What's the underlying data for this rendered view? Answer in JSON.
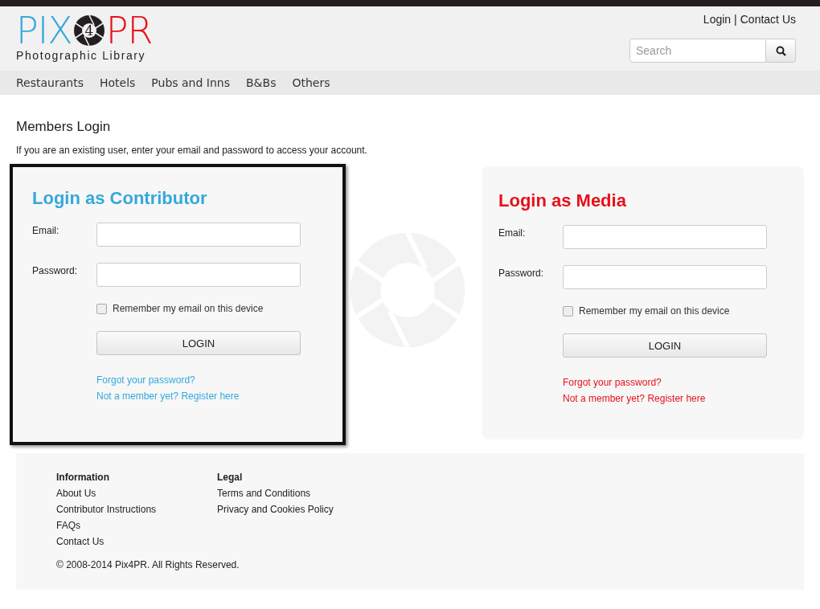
{
  "header": {
    "logo": {
      "left": "PIX",
      "middle": "4",
      "right": "PR",
      "tagline": "Photographic Library"
    },
    "top_links": [
      "Login",
      "|",
      "Contact Us"
    ],
    "search": {
      "placeholder": "Search"
    }
  },
  "nav": [
    "Restaurants",
    "Hotels",
    "Pubs and Inns",
    "B&Bs",
    "Others"
  ],
  "page_title": "Members Login",
  "intro": "If you are an existing user, enter your email and password to access your account.",
  "panels": [
    {
      "title": "Login as Contributor",
      "color": "#35a8dc",
      "highlighted": true,
      "email_label": "Email:",
      "password_label": "Password:",
      "remember": {
        "label": "Remember my email on this device",
        "checked": false
      },
      "button": "LOGIN",
      "links": [
        "Forgot your password?",
        "Not a member yet? Register here"
      ]
    },
    {
      "title": "Login as Media",
      "color": "#e8101a",
      "highlighted": false,
      "email_label": "Email:",
      "password_label": "Password:",
      "remember": {
        "label": "Remember my email on this device",
        "checked": false
      },
      "button": "LOGIN",
      "links": [
        "Forgot your password?",
        "Not a member yet? Register here"
      ]
    }
  ],
  "footer": {
    "columns": [
      {
        "heading": "Information",
        "links": [
          "About Us",
          "Contributor Instructions",
          "FAQs",
          "Contact Us"
        ]
      },
      {
        "heading": "Legal",
        "links": [
          "Terms and Conditions",
          "Privacy and Cookies Policy"
        ]
      }
    ],
    "copyright": "© 2008-2014 Pix4PR. All Rights Reserved."
  }
}
